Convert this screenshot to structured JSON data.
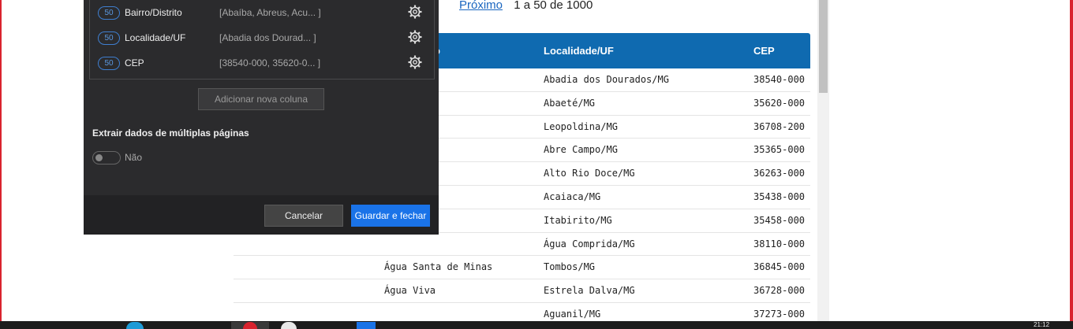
{
  "pager": {
    "next_label": "Próximo",
    "range_text": "1 a 50 de 1000"
  },
  "table": {
    "headers": [
      "ito",
      "Localidade/UF",
      "CEP"
    ],
    "rows": [
      {
        "bairro": "",
        "localidade": "Abadia dos Dourados/MG",
        "cep": "38540-000"
      },
      {
        "bairro": "",
        "localidade": "Abaeté/MG",
        "cep": "35620-000"
      },
      {
        "bairro": "",
        "localidade": "Leopoldina/MG",
        "cep": "36708-200"
      },
      {
        "bairro": "",
        "localidade": "Abre Campo/MG",
        "cep": "35365-000"
      },
      {
        "bairro": "",
        "localidade": "Alto Rio Doce/MG",
        "cep": "36263-000"
      },
      {
        "bairro": "",
        "localidade": "Acaiaca/MG",
        "cep": "35438-000"
      },
      {
        "bairro": "",
        "localidade": "Itabirito/MG",
        "cep": "35458-000"
      },
      {
        "bairro": "",
        "localidade": "Água Comprida/MG",
        "cep": "38110-000"
      },
      {
        "bairro": "Água Santa de Minas",
        "localidade": "Tombos/MG",
        "cep": "36845-000"
      },
      {
        "bairro": "Água Viva",
        "localidade": "Estrela Dalva/MG",
        "cep": "36728-000"
      },
      {
        "bairro": "",
        "localidade": "Aguanil/MG",
        "cep": "37273-000"
      }
    ]
  },
  "panel": {
    "columns": [
      {
        "count": "50",
        "name": "Bairro/Distrito",
        "values": "[Abaíba, Abreus, Acu... ]"
      },
      {
        "count": "50",
        "name": "Localidade/UF",
        "values": "[Abadia dos Dourad... ]"
      },
      {
        "count": "50",
        "name": "CEP",
        "values": "[38540-000, 35620-0... ]"
      }
    ],
    "add_column_label": "Adicionar nova coluna",
    "extract_label": "Extrair dados de múltiplas páginas",
    "toggle_label": "Não",
    "cancel_label": "Cancelar",
    "save_label": "Guardar e fechar"
  },
  "taskbar": {
    "time": "21:12"
  },
  "colors": {
    "accent": "#1a73e8",
    "table_header": "#0f6ab0",
    "frame": "#d9232e"
  }
}
